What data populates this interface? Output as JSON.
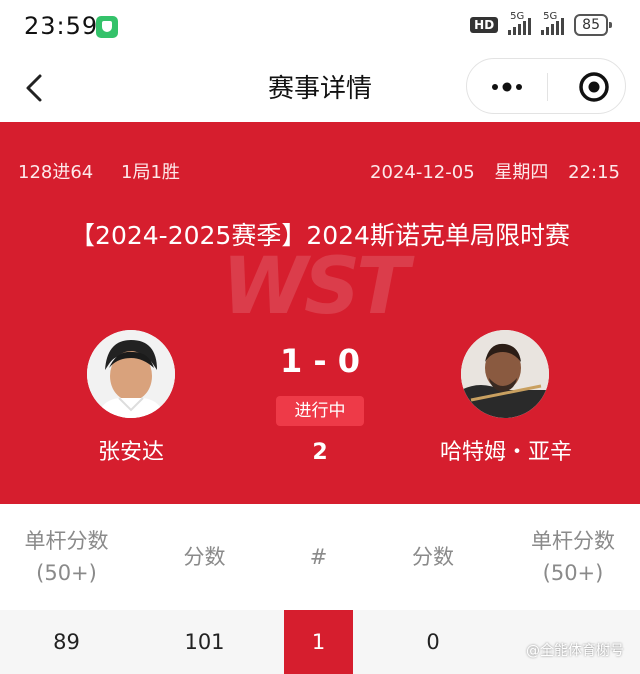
{
  "status_bar": {
    "time": "23:59",
    "network_badge": "HD",
    "signal_1_label": "5G",
    "signal_2_label": "5G",
    "battery": "85"
  },
  "nav": {
    "title": "赛事详情",
    "back_icon": "chevron-left-icon",
    "more_icon": "more-dots-icon",
    "close_icon": "target-icon"
  },
  "match": {
    "round": "128进64",
    "format": "1局1胜",
    "date": "2024-12-05",
    "weekday": "星期四",
    "time": "22:15",
    "event_title": "【2024-2025赛季】2024斯诺克单局限时赛",
    "watermark": "WST",
    "score": "1 - 0",
    "status": "进行中",
    "frame": "2",
    "player_left": {
      "name": "张安达"
    },
    "player_right": {
      "name": "哈特姆・亚辛"
    },
    "accent_color": "#d61e2e"
  },
  "stats": {
    "headers": {
      "left_break": "单杆分数",
      "left_break_sub": "(50+)",
      "left_points": "分数",
      "frame": "#",
      "right_points": "分数",
      "right_break": "单杆分数",
      "right_break_sub": "(50+)"
    },
    "rows": [
      {
        "left_break": "89",
        "left_points": "101",
        "frame": "1",
        "right_points": "0",
        "right_break": ""
      }
    ]
  },
  "credit": "@全能体育榭号"
}
